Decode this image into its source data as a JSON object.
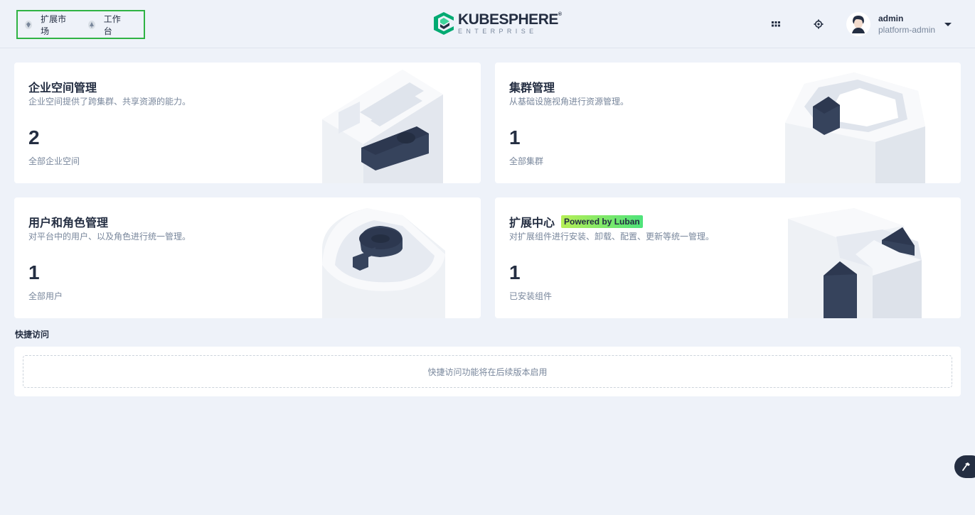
{
  "header": {
    "quick_nav": [
      {
        "label": "扩展市场",
        "icon": "marketplace-icon"
      },
      {
        "label": "工作台",
        "icon": "workbench-icon"
      }
    ],
    "logo": {
      "main": "KUBESPHERE",
      "reg": "®",
      "sub": "ENTERPRISE"
    },
    "icons": [
      "apps-grid-icon",
      "gear-icon"
    ],
    "user": {
      "name": "admin",
      "role": "platform-admin"
    }
  },
  "cards": [
    {
      "title": "企业空间管理",
      "desc": "企业空间提供了跨集群、共享资源的能力。",
      "count": "2",
      "sub": "全部企业空间"
    },
    {
      "title": "集群管理",
      "desc": "从基础设施视角进行资源管理。",
      "count": "1",
      "sub": "全部集群"
    },
    {
      "title": "用户和角色管理",
      "desc": "对平台中的用户、以及角色进行统一管理。",
      "count": "1",
      "sub": "全部用户"
    },
    {
      "title": "扩展中心",
      "badge": "Powered by Luban",
      "desc": "对扩展组件进行安装、卸载、配置、更新等统一管理。",
      "count": "1",
      "sub": "已安装组件"
    }
  ],
  "quick_access": {
    "title": "快捷访问",
    "placeholder": "快捷访问功能将在后续版本启用"
  },
  "colors": {
    "accent": "#2fb344",
    "dark": "#242e42",
    "muted": "#79879c",
    "background": "#eef2f9"
  }
}
